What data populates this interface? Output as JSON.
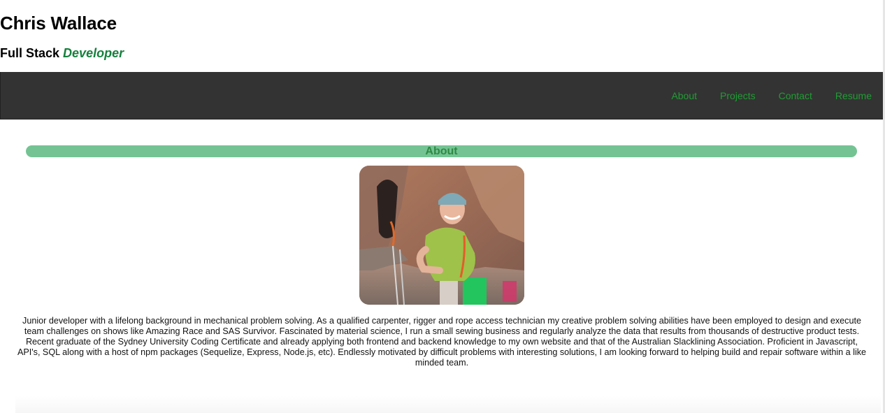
{
  "header": {
    "name": "Chris Wallace",
    "role_prefix": "Full Stack",
    "role_accent": "Developer"
  },
  "nav": {
    "items": [
      "About",
      "Projects",
      "Contact",
      "Resume"
    ]
  },
  "about": {
    "title": "About",
    "bio": "Junior developer with a lifelong background in mechanical problem solving. As a qualified carpenter, rigger and rope access technician my creative problem solving abilities have been employed to design and execute team challenges on shows like Amazing Race and SAS Survivor. Fascinated by material science, I run a small sewing business and regularly analyze the data that results from thousands of destructive product tests. Recent graduate of the Sydney University Coding Certificate and already applying both frontend and backend knowledge to my own website and that of the Australian Slacklining Association. Proficient in Javascript, API's, SQL along with a host of npm packages (Sequelize, Express, Node.js, etc). Endlessly motivated by difficult problems with interesting solutions, I am looking forward to helping build and repair software within a like minded team."
  },
  "colors": {
    "navbar_bg": "#333333",
    "nav_link": "#1e9e33",
    "accent": "#15803d",
    "banner_bg": "#74c493",
    "banner_text": "#2f8a43"
  }
}
